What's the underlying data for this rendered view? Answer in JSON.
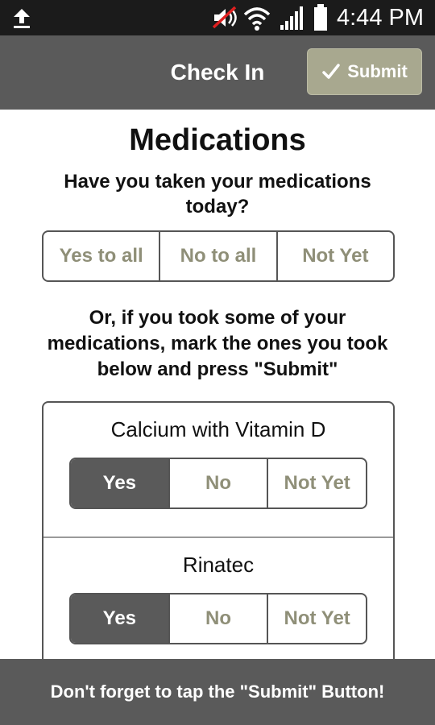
{
  "status_bar": {
    "time": "4:44 PM",
    "icons": [
      "upload-icon",
      "mute-icon",
      "wifi-icon",
      "signal-icon",
      "battery-icon"
    ]
  },
  "header": {
    "title": "Check In",
    "submit_label": "Submit",
    "submit_icon": "check-icon"
  },
  "main": {
    "heading": "Medications",
    "question": "Have you taken your medications today?",
    "bulk_options": [
      "Yes to all",
      "No to all",
      "Not Yet"
    ],
    "instructions": "Or, if you took some of your medications, mark the ones you took below and press \"Submit\"",
    "medications": [
      {
        "name": "Calcium with Vitamin D",
        "options": [
          "Yes",
          "No",
          "Not Yet"
        ],
        "selected": "Yes"
      },
      {
        "name": "Rinatec",
        "options": [
          "Yes",
          "No",
          "Not Yet"
        ],
        "selected": "Yes"
      }
    ]
  },
  "footer": {
    "reminder": "Don't forget to tap the \"Submit\" Button!"
  },
  "colors": {
    "status_bar_bg": "#1b1b1b",
    "action_bar_bg": "#5a5a5a",
    "submit_bg": "#a8a88f",
    "option_text": "#8f8f78",
    "selected_bg": "#5a5a5a"
  }
}
